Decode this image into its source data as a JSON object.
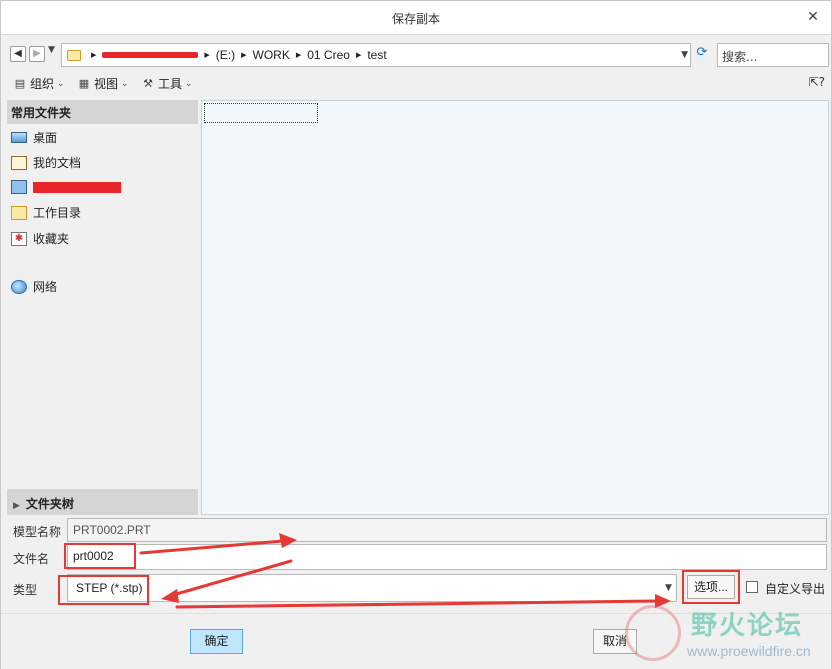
{
  "window": {
    "title": "保存副本",
    "close_glyph": "✕"
  },
  "nav": {
    "back_icon": "back-arrow-icon",
    "forward_icon": "forward-arrow-icon",
    "breadcrumbs": [
      "(E:)",
      "WORK",
      "01 Creo",
      "test"
    ],
    "search_placeholder": "搜索..."
  },
  "toolbar": {
    "organize": "组织",
    "view": "视图",
    "tools": "工具",
    "help_glyph": "?"
  },
  "sidebar": {
    "section_title": "常用文件夹",
    "items": [
      {
        "label": "桌面",
        "icon": "desktop-icon"
      },
      {
        "label": "我的文档",
        "icon": "documents-icon"
      },
      {
        "label": "",
        "icon": "computer-icon"
      },
      {
        "label": "工作目录",
        "icon": "working-dir-icon"
      },
      {
        "label": "收藏夹",
        "icon": "favorites-icon"
      },
      {
        "label": "网络",
        "icon": "network-icon"
      }
    ],
    "tree_title": "文件夹树"
  },
  "form": {
    "model_name_label": "模型名称",
    "model_name_value": "PRT0002.PRT",
    "file_name_label": "文件名",
    "file_name_value": "prt0002",
    "type_label": "类型",
    "type_value": "STEP (*.stp)",
    "options_button": "选项...",
    "custom_export_label": "自定义导出",
    "custom_export_checked": false
  },
  "buttons": {
    "ok": "确定",
    "cancel": "取消"
  },
  "watermark": {
    "title": "野火论坛",
    "url": "www.proewildfire.cn"
  },
  "colors": {
    "annotation_red": "#e53935",
    "ok_button": "#bfe6fb",
    "file_pane": "#f2f8fb"
  }
}
